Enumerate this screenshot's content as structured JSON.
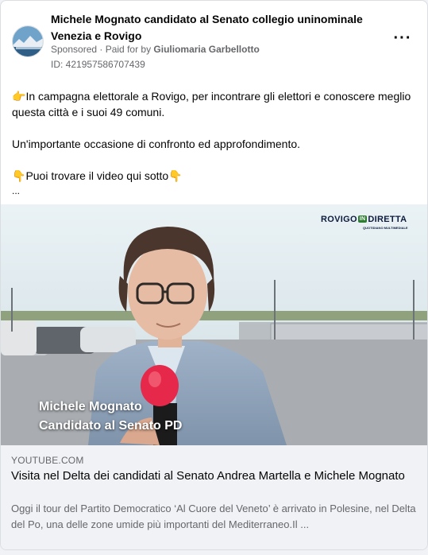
{
  "post": {
    "title": "Michele Mognato candidato al Senato collegio uninominale Venezia e Rovigo",
    "sponsored": "Sponsored",
    "paid_prefix": " · Paid for by ",
    "payer": "Giuliomaria Garbellotto",
    "ad_id": "ID: 421957586707439",
    "more_label": "···"
  },
  "body": {
    "line1_emoji": "👉",
    "line1": "In campagna elettorale a Rovigo, per incontrare gli elettori e conoscere meglio questa città e i suoi 49 comuni.",
    "line2": "Un'importante occasione di confronto ed approfondimento.",
    "line3_emoji": "👇",
    "line3": "Puoi trovare il video qui sotto",
    "line3_emoji_end": "👇",
    "ellipsis": "..."
  },
  "media": {
    "logo_left": "ROVIGO",
    "logo_in": "IN",
    "logo_right": "DIRETTA",
    "logo_sub": "QUOTIDIANO MULTIMEDIALE",
    "overlay_name": "Michele Mognato",
    "overlay_role": "Candidato al Senato PD"
  },
  "link": {
    "domain": "YOUTUBE.COM",
    "title": "Visita nel Delta dei candidati al Senato Andrea Martella e Michele Mognato",
    "description": "Oggi il tour del Partito Democratico ‘Al Cuore del Veneto’ è arrivato in Polesine, nel Delta del Po, una delle zone umide più importanti del Mediterraneo.Il ..."
  },
  "icons": {
    "avatar": "page-avatar",
    "more": "more-options-icon"
  }
}
